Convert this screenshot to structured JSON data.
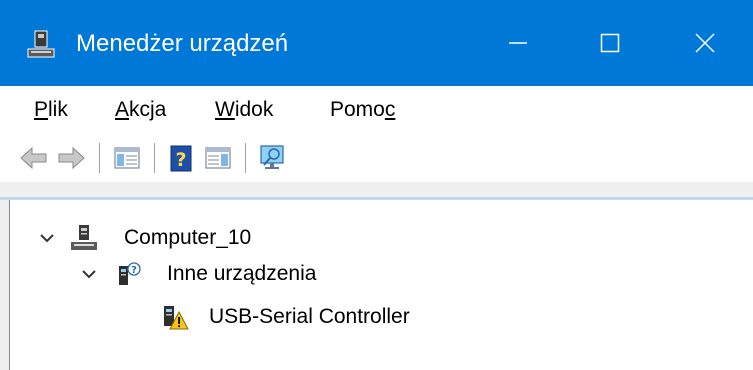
{
  "window": {
    "title": "Menedżer urządzeń",
    "controls": {
      "minimize": "minimize",
      "maximize": "maximize",
      "close": "close"
    },
    "accent_color": "#0078d7"
  },
  "menu": {
    "items": [
      {
        "label": "Plik",
        "accel": "P",
        "rest": "lik"
      },
      {
        "label": "Akcja",
        "accel": "A",
        "rest": "kcja"
      },
      {
        "label": "Widok",
        "accel": "W",
        "rest": "idok"
      },
      {
        "label": "Pomoc",
        "before": "Pomo",
        "accel": "c"
      }
    ]
  },
  "toolbar": {
    "buttons": [
      {
        "name": "back",
        "icon": "back-arrow-icon"
      },
      {
        "name": "forward",
        "icon": "forward-arrow-icon"
      },
      {
        "name": "show-hide-console-tree",
        "icon": "console-tree-icon"
      },
      {
        "name": "help",
        "icon": "help-icon",
        "glyph": "?"
      },
      {
        "name": "show-hide-action-pane",
        "icon": "action-pane-icon"
      },
      {
        "name": "scan-hardware",
        "icon": "scan-monitor-icon"
      }
    ]
  },
  "tree": {
    "nodes": [
      {
        "label": "Computer_10",
        "expanded": true,
        "icon": "computer-icon",
        "level": 0
      },
      {
        "label": "Inne urządzenia",
        "expanded": true,
        "icon": "unknown-device-icon",
        "level": 1
      },
      {
        "label": "USB-Serial Controller",
        "icon": "device-warning-icon",
        "level": 2
      }
    ]
  }
}
